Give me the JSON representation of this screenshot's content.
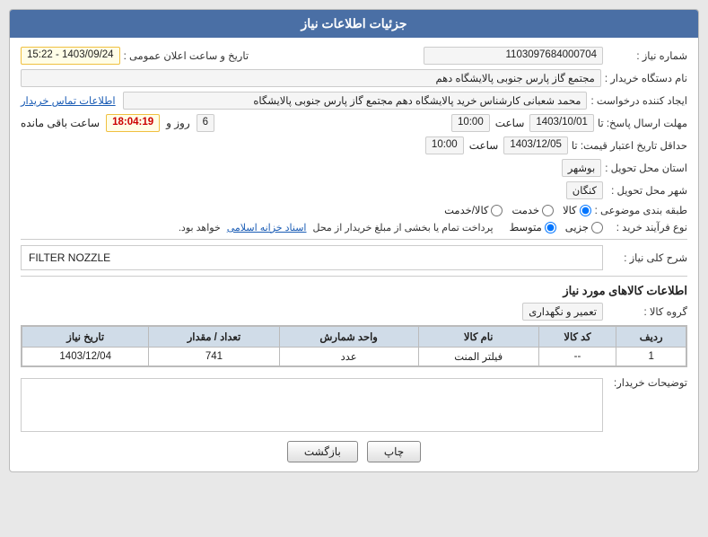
{
  "header": {
    "title": "جزئیات اطلاعات نیاز"
  },
  "fields": {
    "shomare_niaz_label": "شماره نیاز :",
    "shomare_niaz_value": "1103097684000704",
    "tarikh_label": "تاریخ و ساعت اعلان عمومی :",
    "tarikh_value": "1403/09/24 - 15:22",
    "nam_dastgah_label": "نام دستگاه خریدار :",
    "nam_dastgah_value": "مجتمع گاز پارس جنوبی  پالایشگاه دهم",
    "ijad_label": "ایجاد کننده درخواست :",
    "ijad_value": "محمد شعبانی کارشناس خرید پالایشگاه دهم  مجتمع گاز پارس جنوبی  پالایشگاه",
    "ijad_link": "اطلاعات تماس خریدار",
    "mohlet_label": "مهلت ارسال پاسخ: تا",
    "mohlet_date": "1403/10/01",
    "mohlet_time": "10:00",
    "mohlet_day_label": "روز و",
    "mohlet_days": "6",
    "mohlet_remaining": "18:04:19",
    "mohlet_remaining_label": "ساعت باقی مانده",
    "hadaghal_label": "حداقل تاریخ اعتبار قیمت: تا",
    "hadaghal_date": "1403/12/05",
    "hadaghal_time": "10:00",
    "ostan_label": "استان محل تحویل :",
    "ostan_value": "بوشهر",
    "shahr_label": "شهر محل تحویل :",
    "shahr_value": "کنگان",
    "tabaqe_label": "طبقه بندی موضوعی :",
    "tabaqe_options": [
      "کالا",
      "خدمت",
      "کالا/خدمت"
    ],
    "tabaqe_selected": "کالا",
    "nooe_farayand_label": "نوع فرآیند خرید :",
    "nooe_farayand_options": [
      "جزیی",
      "متوسط"
    ],
    "nooe_farayand_selected": "متوسط",
    "nooe_farayand_note": "پرداخت تمام یا بخشی از مبلغ خریدار از محل",
    "nooe_farayand_link": "اسناد خزانه اسلامی",
    "nooe_farayand_end": "خواهد بود.",
    "sharh_label": "شرح کلی نیاز :",
    "sharh_value": "FILTER NOZZLE",
    "kalahai_section": "اطلاعات کالاهای مورد نیاز",
    "group_label": "گروه کالا :",
    "group_value": "تعمیر و نگهداری",
    "table_headers": {
      "radif": "ردیف",
      "code": "کد کالا",
      "name": "نام کالا",
      "unit": "واحد شمارش",
      "count": "تعداد / مقدار",
      "date": "تاریخ نیاز"
    },
    "table_rows": [
      {
        "radif": "1",
        "code": "--",
        "name": "فیلتر المنت",
        "unit": "عدد",
        "count": "741",
        "date": "1403/12/04"
      }
    ],
    "tozih_label": "توضیحات خریدار:",
    "buttons": {
      "print": "چاپ",
      "back": "بازگشت"
    }
  }
}
